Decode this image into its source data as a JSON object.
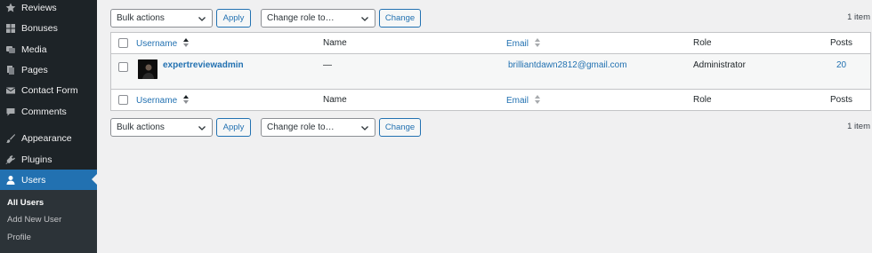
{
  "sidebar": {
    "items": [
      {
        "label": "Reviews",
        "icon": "star-icon"
      },
      {
        "label": "Bonuses",
        "icon": "grid-icon"
      },
      {
        "label": "Media",
        "icon": "media-icon"
      },
      {
        "label": "Pages",
        "icon": "pages-icon"
      },
      {
        "label": "Contact Form",
        "icon": "mail-icon"
      },
      {
        "label": "Comments",
        "icon": "comment-icon"
      },
      {
        "label": "Appearance",
        "icon": "brush-icon"
      },
      {
        "label": "Plugins",
        "icon": "plugin-icon"
      },
      {
        "label": "Users",
        "icon": "user-icon",
        "active": true
      }
    ],
    "submenu": [
      "All Users",
      "Add New User",
      "Profile"
    ]
  },
  "toolbar": {
    "bulk_actions": "Bulk actions",
    "apply": "Apply",
    "change_role": "Change role to…",
    "change": "Change",
    "count": "1 item"
  },
  "table": {
    "headers": {
      "username": "Username",
      "name": "Name",
      "email": "Email",
      "role": "Role",
      "posts": "Posts"
    },
    "rows": [
      {
        "username": "expertreviewadmin",
        "name": "—",
        "email": "brilliantdawn2812@gmail.com",
        "role": "Administrator",
        "posts": "20"
      }
    ]
  },
  "colors": {
    "sidebar_bg": "#1d2327",
    "accent": "#2271b1",
    "page_bg": "#f0f0f1"
  }
}
